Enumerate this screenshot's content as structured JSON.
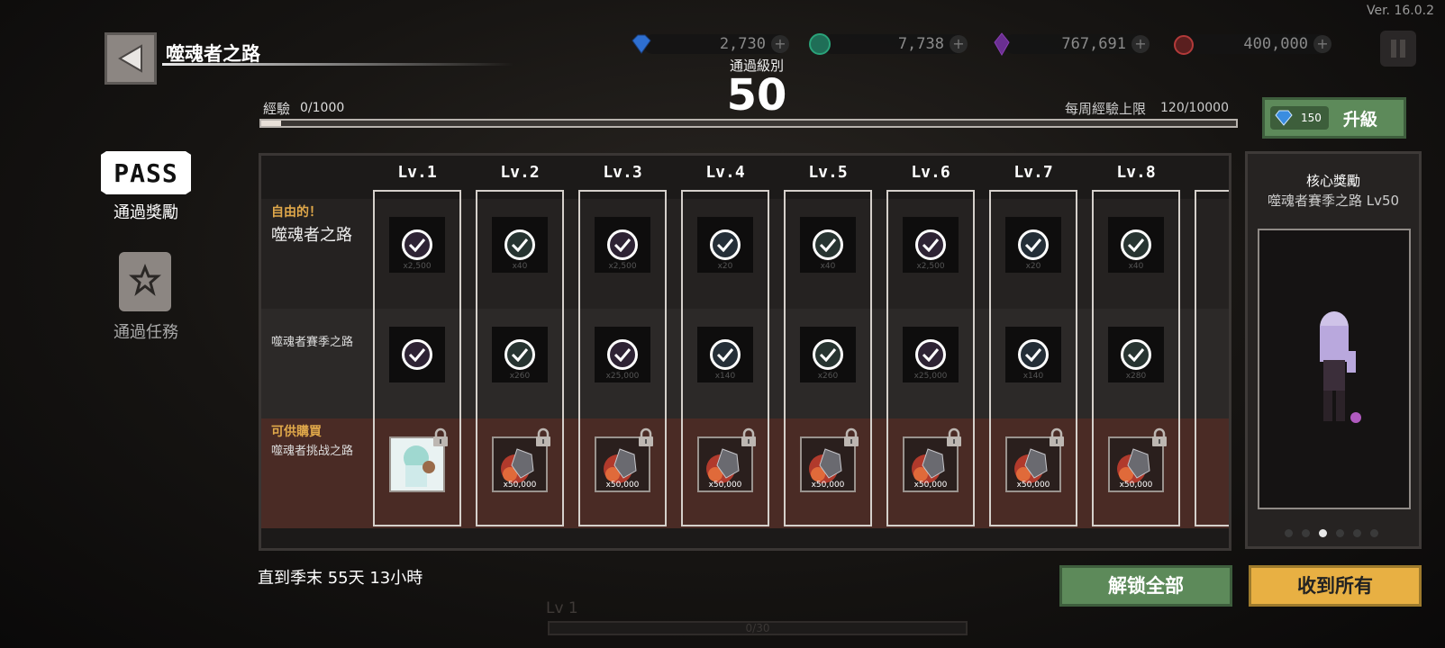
{
  "version": "Ver. 16.0.2",
  "header": {
    "title": "噬魂者之路",
    "currencies": [
      {
        "icon": "diamond-icon",
        "value": "2,730",
        "color": "#2e6fd1"
      },
      {
        "icon": "emerald-coin-icon",
        "value": "7,738",
        "color": "#2aa37a"
      },
      {
        "icon": "crystal-icon",
        "value": "767,691",
        "color": "#8a3fb5"
      },
      {
        "icon": "soul-orb-icon",
        "value": "400,000",
        "color": "#b33a3a"
      }
    ],
    "pass_level_label": "通過級別",
    "pass_level": "50",
    "exp_label": "經驗",
    "exp_value": "0/1000",
    "exp_progress": 0.02,
    "weekly_label": "每周經驗上限",
    "weekly_value": "120/10000",
    "upgrade_cost": "150",
    "upgrade_label": "升級"
  },
  "sidebar": {
    "pass_tab": "PASS",
    "pass_tab_label": "通過獎勵",
    "mission_label": "通過任務"
  },
  "rows": {
    "free_tag": "自由的！",
    "free_name": "噬魂者之路",
    "season_name": "噬魂者賽季之路",
    "buy_tag": "可供購買",
    "buy_name": "噬魂者挑战之路"
  },
  "levels": [
    {
      "label": "Lv.1",
      "free_qty": "x2,500",
      "season_qty": "",
      "premium_qty": ""
    },
    {
      "label": "Lv.2",
      "free_qty": "x40",
      "season_qty": "x260",
      "premium_qty": "x50,000"
    },
    {
      "label": "Lv.3",
      "free_qty": "x2,500",
      "season_qty": "x25,000",
      "premium_qty": "x50,000"
    },
    {
      "label": "Lv.4",
      "free_qty": "x20",
      "season_qty": "x140",
      "premium_qty": "x50,000"
    },
    {
      "label": "Lv.5",
      "free_qty": "x40",
      "season_qty": "x260",
      "premium_qty": "x50,000"
    },
    {
      "label": "Lv.6",
      "free_qty": "x2,500",
      "season_qty": "x25,000",
      "premium_qty": "x50,000"
    },
    {
      "label": "Lv.7",
      "free_qty": "x20",
      "season_qty": "x140",
      "premium_qty": "x50,000"
    },
    {
      "label": "Lv.8",
      "free_qty": "x40",
      "season_qty": "x280",
      "premium_qty": "x50,000"
    }
  ],
  "core": {
    "title": "核心獎勵",
    "subtitle": "噬魂者賽季之路 Lv50",
    "page_dots": 6,
    "active_dot": 2
  },
  "footer": {
    "season_end": "直到季末 55天 13小時",
    "unlock_all": "解锁全部",
    "collect_all": "收到所有",
    "bottom_level": "Lv 1",
    "bottom_progress": "0/30"
  }
}
